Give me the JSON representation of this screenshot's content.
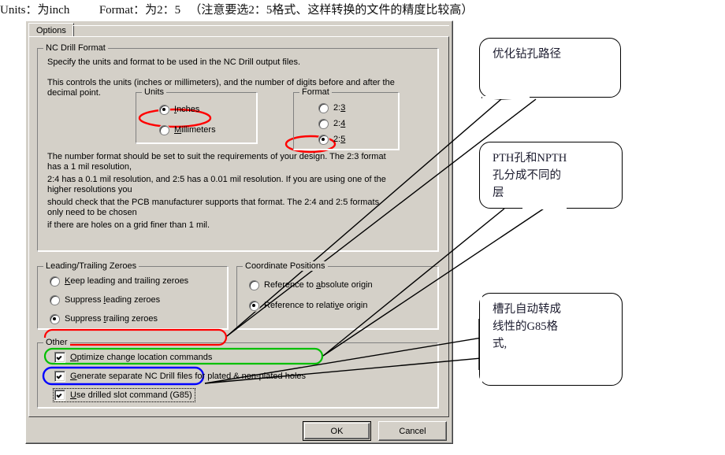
{
  "header_note": "Units：为inch          Format：为2：5   （注意要选2：5格式、这样转换的文件的精度比较高）",
  "dialog": {
    "tab": {
      "label": "Options"
    },
    "nc_drill_format": {
      "title": "NC Drill Format",
      "line1": "Specify the units and format to be used in the NC Drill output files.",
      "line2": "This controls the units (inches or millimeters), and the number of digits before and after the",
      "line3": "decimal point.",
      "units": {
        "title": "Units",
        "options": [
          {
            "label": "Inches",
            "accel": "I",
            "selected": true
          },
          {
            "label": "Millimeters",
            "accel": "M",
            "selected": false
          }
        ]
      },
      "format": {
        "title": "Format",
        "options": [
          {
            "label": "2:3",
            "accel": "3",
            "selected": false
          },
          {
            "label": "2:4",
            "accel": "4",
            "selected": false
          },
          {
            "label": "2:5",
            "accel": "5",
            "selected": true
          }
        ]
      },
      "note": [
        "The number format should be set to suit the requirements of your design. The 2:3 format",
        "has a 1 mil resolution,",
        "2:4 has a 0.1 mil resolution, and 2:5 has a 0.01 mil resolution. If you are using one of the",
        "higher resolutions you",
        "should check that the PCB manufacturer supports that format. The 2:4 and 2:5 formats",
        "only need to be chosen",
        "if there are holes on a grid finer than 1 mil."
      ]
    },
    "zeroes": {
      "title": "Leading/Trailing Zeroes",
      "options": [
        {
          "label": "Keep leading and trailing zeroes",
          "selected": false
        },
        {
          "label": "Suppress leading zeroes",
          "selected": false
        },
        {
          "label": "Suppress trailing zeroes",
          "selected": true
        }
      ]
    },
    "coordinates": {
      "title": "Coordinate Positions",
      "options": [
        {
          "label": "Reference to absolute origin",
          "selected": false
        },
        {
          "label": "Reference to relative origin",
          "selected": true
        }
      ]
    },
    "other": {
      "title": "Other",
      "options": [
        {
          "label": "Optimize change location commands",
          "checked": true,
          "outline": "#ff0000"
        },
        {
          "label": "Generate separate NC Drill files for plated & non-plated holes",
          "checked": true,
          "outline": "#00c000"
        },
        {
          "label": "Use drilled slot command (G85)",
          "checked": true,
          "outline": "#0000ff",
          "focused": true
        }
      ]
    },
    "buttons": {
      "ok": "OK",
      "cancel": "Cancel"
    }
  },
  "annotations": {
    "highlight_color_units": "#ff0000",
    "highlight_color_format": "#ff0000",
    "callouts": [
      {
        "text": "优化钻孔路径"
      },
      {
        "text": "PTH孔和NPTH\n孔分成不同的\n层"
      },
      {
        "text": "槽孔自动转成\n线性的G85格\n式,"
      }
    ]
  }
}
